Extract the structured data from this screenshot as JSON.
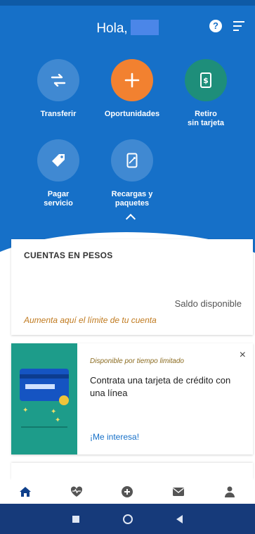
{
  "header": {
    "greeting": "Hola,"
  },
  "actions": [
    {
      "label": "Transferir",
      "icon": "transfer-arrows-icon"
    },
    {
      "label": "Oportunidades",
      "icon": "plus-icon"
    },
    {
      "label": "Retiro\nsin tarjeta",
      "icon": "cash-withdrawal-icon"
    },
    {
      "label": "Pagar\nservicio",
      "icon": "tag-icon"
    },
    {
      "label": "Recargas y\npaquetes",
      "icon": "phone-recharge-icon"
    }
  ],
  "accounts_card": {
    "title": "CUENTAS EN PESOS",
    "balance_label": "Saldo disponible",
    "limit_link": "Aumenta aquí el límite de tu cuenta"
  },
  "offer_card": {
    "badge": "Disponible por tiempo limitado",
    "headline": "Contrata una tarjeta de crédito con una línea",
    "cta": "¡Me interesa!",
    "close": "×"
  },
  "bottom_nav": [
    {
      "icon": "home-icon",
      "active": true
    },
    {
      "icon": "heart-pulse-icon",
      "active": false
    },
    {
      "icon": "plus-circle-icon",
      "active": false
    },
    {
      "icon": "mail-icon",
      "active": false
    },
    {
      "icon": "profile-icon",
      "active": false
    }
  ],
  "colors": {
    "header_blue": "#1670c8",
    "orange": "#f28130",
    "green": "#1e8e7a",
    "link_orange": "#c07a1f",
    "nav_active": "#0e3f8a"
  }
}
